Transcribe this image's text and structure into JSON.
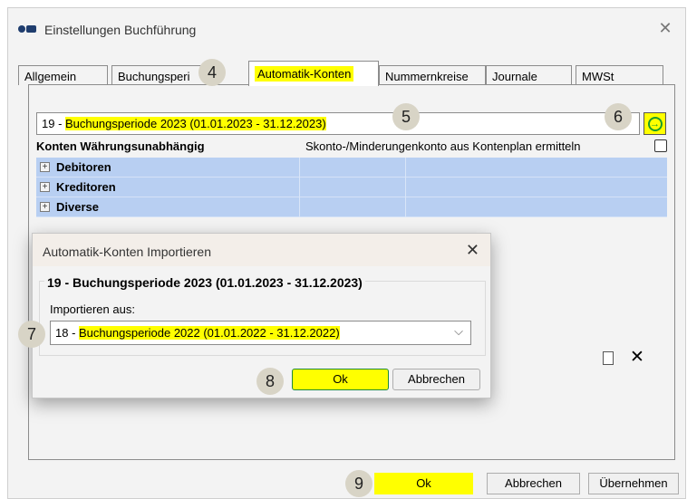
{
  "window": {
    "title": "Einstellungen Buchführung",
    "close_glyph": "✕"
  },
  "tabs": [
    {
      "label": "Allgemein"
    },
    {
      "label": "Buchungsperi"
    },
    {
      "label": "Automatik-Konten",
      "active": true
    },
    {
      "label": "Nummernkreise"
    },
    {
      "label": "Journale"
    },
    {
      "label": "MWSt"
    }
  ],
  "period_select": {
    "prefix": "19 - ",
    "value": "Buchungsperiode 2023 (01.01.2023 - 31.12.2023)"
  },
  "konten": {
    "title": "Konten Währungsunabhängig",
    "skonto_label": "Skonto-/Minderungenkonto aus Kontenplan ermitteln",
    "skonto_checked": false,
    "rows": [
      {
        "label": "Debitoren",
        "expand": "+"
      },
      {
        "label": "Kreditoren",
        "expand": "+"
      },
      {
        "label": "Diverse",
        "expand": "+"
      }
    ]
  },
  "toolbar": {
    "delete_glyph": "✕"
  },
  "dialog": {
    "title": "Automatik-Konten Importieren",
    "close_glyph": "✕",
    "heading": "19 - Buchungsperiode 2023 (01.01.2023 - 31.12.2023)",
    "import_label": "Importieren aus:",
    "select_prefix": "18 - ",
    "select_value": "Buchungsperiode 2022 (01.01.2022 - 31.12.2022)",
    "chevron": "⌵",
    "ok_label": "Ok",
    "cancel_label": "Abbrechen"
  },
  "footer": {
    "ok_label": "Ok",
    "cancel_label": "Abbrechen",
    "apply_label": "Übernehmen"
  },
  "badges": [
    "4",
    "5",
    "6",
    "7",
    "8",
    "9"
  ],
  "colors": {
    "highlight": "#ffff00",
    "grid_row": "#b8cff2",
    "badge": "#d8d4c6",
    "arrow": "#1a9b2b"
  }
}
